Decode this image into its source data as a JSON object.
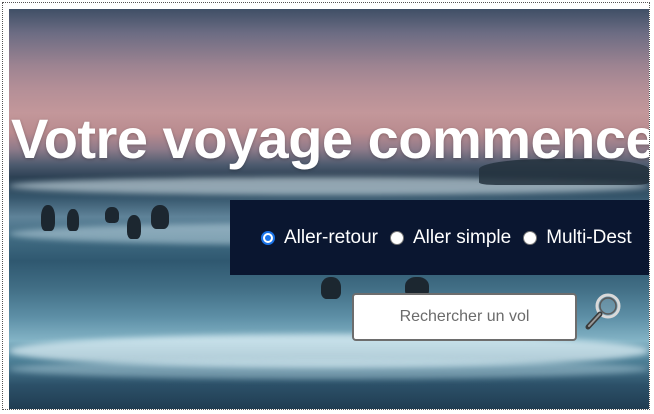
{
  "hero": {
    "title": "Votre voyage commence"
  },
  "trip_type": {
    "options": [
      {
        "label": "Aller-retour",
        "selected": true
      },
      {
        "label": "Aller simple",
        "selected": false
      },
      {
        "label": "Multi-Dest",
        "selected": false
      }
    ]
  },
  "search": {
    "placeholder": "Rechercher un vol",
    "icon": "magnifier-icon"
  },
  "colors": {
    "trip_bar_background": "#0a1630",
    "selected_radio": "#1a73e8",
    "title_text": "#ffffff"
  }
}
